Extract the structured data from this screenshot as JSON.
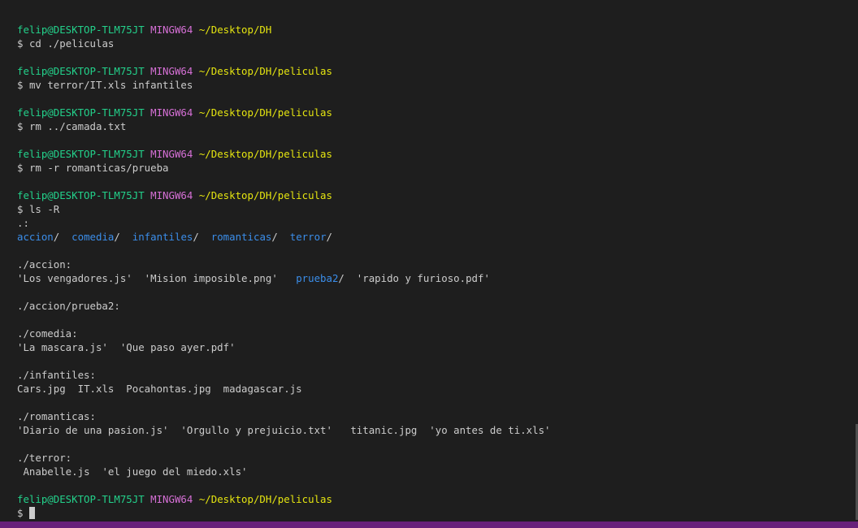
{
  "prompt": {
    "user": "felip@DESKTOP-TLM75JT",
    "system": "MINGW64",
    "path_dh": "~/Desktop/DH",
    "path_peliculas": "~/Desktop/DH/peliculas",
    "symbol": "$"
  },
  "commands": [
    "cd ./peliculas",
    "mv terror/IT.xls infantiles",
    "rm ../camada.txt",
    "rm -r romanticas/prueba",
    "ls -R"
  ],
  "listing": {
    "root_header": ".:",
    "root_dirs": [
      "accion",
      "comedia",
      "infantiles",
      "romanticas",
      "terror"
    ],
    "accion": {
      "header": "./accion:",
      "file1": "'Los vengadores.js'",
      "file2": "'Mision imposible.png'",
      "dir1": "prueba2",
      "file3": "'rapido y furioso.pdf'"
    },
    "accion_prueba2": {
      "header": "./accion/prueba2:"
    },
    "comedia": {
      "header": "./comedia:",
      "file1": "'La mascara.js'",
      "file2": "'Que paso ayer.pdf'"
    },
    "infantiles": {
      "header": "./infantiles:",
      "file1": "Cars.jpg",
      "file2": "IT.xls",
      "file3": "Pocahontas.jpg",
      "file4": "madagascar.js"
    },
    "romanticas": {
      "header": "./romanticas:",
      "file1": "'Diario de una pasion.js'",
      "file2": "'Orgullo y prejuicio.txt'",
      "file3": "titanic.jpg",
      "file4": "'yo antes de ti.xls'"
    },
    "terror": {
      "header": "./terror:",
      "file1": "Anabelle.js",
      "file2": "'el juego del miedo.xls'"
    }
  },
  "colors": {
    "background": "#1e1e1e",
    "text": "#cccccc",
    "user": "#23d18b",
    "system": "#d670d6",
    "path": "#e5e510",
    "directory": "#3b8eea",
    "statusbar": "#68217a"
  }
}
